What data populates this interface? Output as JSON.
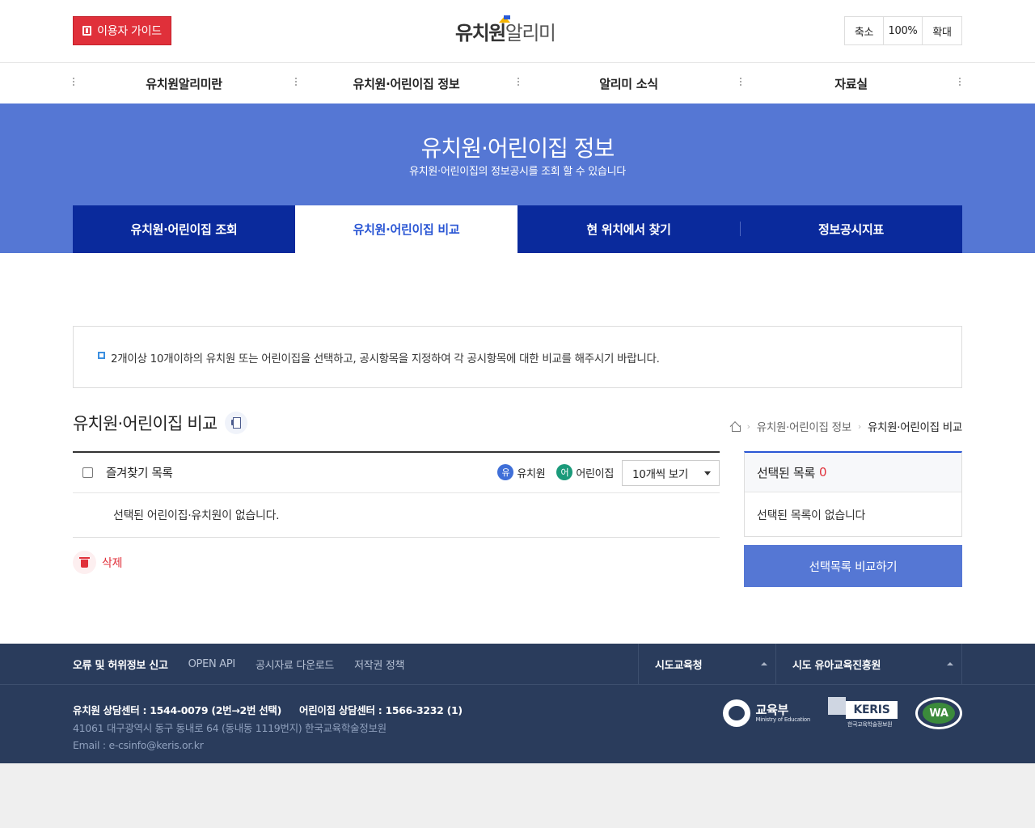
{
  "header": {
    "guide_label": "이용자 가이드",
    "logo_text_1": "유치원",
    "logo_text_2": "알리미",
    "zoom": {
      "out": "축소",
      "level": "100%",
      "in": "확대"
    }
  },
  "gnb": [
    "유치원알리미란",
    "유치원·어린이집 정보",
    "알리미 소식",
    "자료실"
  ],
  "banner": {
    "title": "유치원·어린이집 정보",
    "subtitle": "유치원·어린이집의 정보공시를 조회 할 수 있습니다"
  },
  "tabs": [
    "유치원·어린이집 조회",
    "유치원·어린이집 비교",
    "현 위치에서 찾기",
    "정보공시지표"
  ],
  "notice": "2개이상 10개이하의 유치원 또는 어린이집을 선택하고, 공시항목을 지정하여 각 공시항목에 대한 비교를 해주시기 바랍니다.",
  "section": {
    "title": "유치원·어린이집 비교",
    "breadcrumb": [
      "유치원·어린이집 정보",
      "유치원·어린이집 비교"
    ]
  },
  "list": {
    "favorites_label": "즐겨찾기 목록",
    "legend_k_badge": "유",
    "legend_k_label": "유치원",
    "legend_d_badge": "어",
    "legend_d_label": "어린이집",
    "page_size": "10개씩 보기",
    "empty": "선택된 어린이집·유치원이 없습니다.",
    "delete_label": "삭제"
  },
  "selected": {
    "title": "선택된 목록",
    "count": "0",
    "empty": "선택된 목록이 없습니다",
    "compare_label": "선택목록 비교하기"
  },
  "footer": {
    "links": [
      "오류 및 허위정보 신고",
      "OPEN API",
      "공시자료 다운로드",
      "저작권 정책"
    ],
    "select1": "시도교육청",
    "select2": "시도 유아교육진흥원",
    "tel_kinder": "유치원 상담센터 : 1544-0079 (2번→2번 선택)",
    "tel_daycare": "어린이집 상담센터 : 1566-3232 (1)",
    "address": "41061 대구광역시 동구 동내로 64 (동내동 1119번지) 한국교육학술정보원",
    "email": "Email : e-csinfo@keris.or.kr",
    "moe_name": "교육부",
    "moe_en": "Ministry of Education",
    "keris": "KERIS",
    "keris_caption": "한국교육학술정보원",
    "wa": "WA"
  },
  "colors": {
    "accent": "#5577d4",
    "tab_bg": "#0a2a9c",
    "danger": "#e0303a",
    "footer_bg": "#2a3c5c"
  }
}
